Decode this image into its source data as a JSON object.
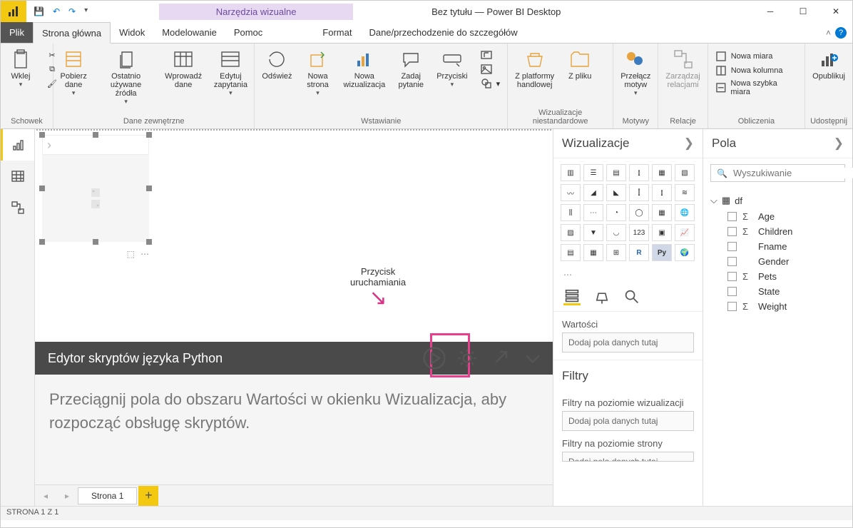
{
  "window": {
    "contextTab": "Narzędzia wizualne",
    "title": "Bez tytułu — Power BI Desktop"
  },
  "qat": [
    "💾"
  ],
  "tabs": {
    "file": "Plik",
    "items": [
      "Strona główna",
      "Widok",
      "Modelowanie",
      "Pomoc"
    ],
    "contextual": [
      "Format",
      "Dane/przechodzenie do szczegółów"
    ]
  },
  "ribbon": {
    "clipboard": {
      "paste": "Wklej",
      "label": "Schowek"
    },
    "external": {
      "get": "Pobierz\ndane",
      "recent": "Ostatnio\nużywane źródła",
      "enter": "Wprowadź\ndane",
      "edit": "Edytuj\nzapytania",
      "label": "Dane zewnętrzne"
    },
    "refresh": "Odśwież",
    "insert": {
      "page": "Nowa\nstrona",
      "visual": "Nowa\nwizualizacja",
      "ask": "Zadaj\npytanie",
      "buttons": "Przyciski",
      "label": "Wstawianie"
    },
    "custom": {
      "market": "Z platformy\nhandlowej",
      "file": "Z pliku",
      "label": "Wizualizacje niestandardowe"
    },
    "themes": {
      "switch": "Przełącz\nmotyw",
      "label": "Motywy"
    },
    "relations": {
      "manage": "Zarządzaj\nrelacjami",
      "label": "Relacje"
    },
    "calc": {
      "measure": "Nowa miara",
      "column": "Nowa kolumna",
      "quick": "Nowa szybka miara",
      "label": "Obliczenia"
    },
    "share": {
      "publish": "Opublikuj",
      "label": "Udostępnij"
    }
  },
  "annotation": {
    "line1": "Przycisk",
    "line2": "uruchamiania"
  },
  "script": {
    "title": "Edytor skryptów języka Python",
    "body": "Przeciągnij pola do obszaru Wartości w okienku Wizualizacja, aby rozpocząć obsługę skryptów."
  },
  "pages": {
    "tab": "Strona 1"
  },
  "vizpane": {
    "title": "Wizualizacje",
    "values": "Wartości",
    "drop": "Dodaj pola danych tutaj",
    "filters": "Filtry",
    "visualFilters": "Filtry na poziomie wizualizacji",
    "drop2": "Dodaj pola danych tutaj",
    "pageFilters": "Filtry na poziomie strony",
    "drop3": "Dodaj pola danych tutaj"
  },
  "fieldspane": {
    "title": "Pola",
    "searchPlaceholder": "Wyszukiwanie",
    "table": "df",
    "fields": [
      {
        "name": "Age",
        "sigma": true
      },
      {
        "name": "Children",
        "sigma": true
      },
      {
        "name": "Fname",
        "sigma": false
      },
      {
        "name": "Gender",
        "sigma": false
      },
      {
        "name": "Pets",
        "sigma": true
      },
      {
        "name": "State",
        "sigma": false
      },
      {
        "name": "Weight",
        "sigma": true
      }
    ]
  },
  "status": "STRONA 1 Z 1"
}
